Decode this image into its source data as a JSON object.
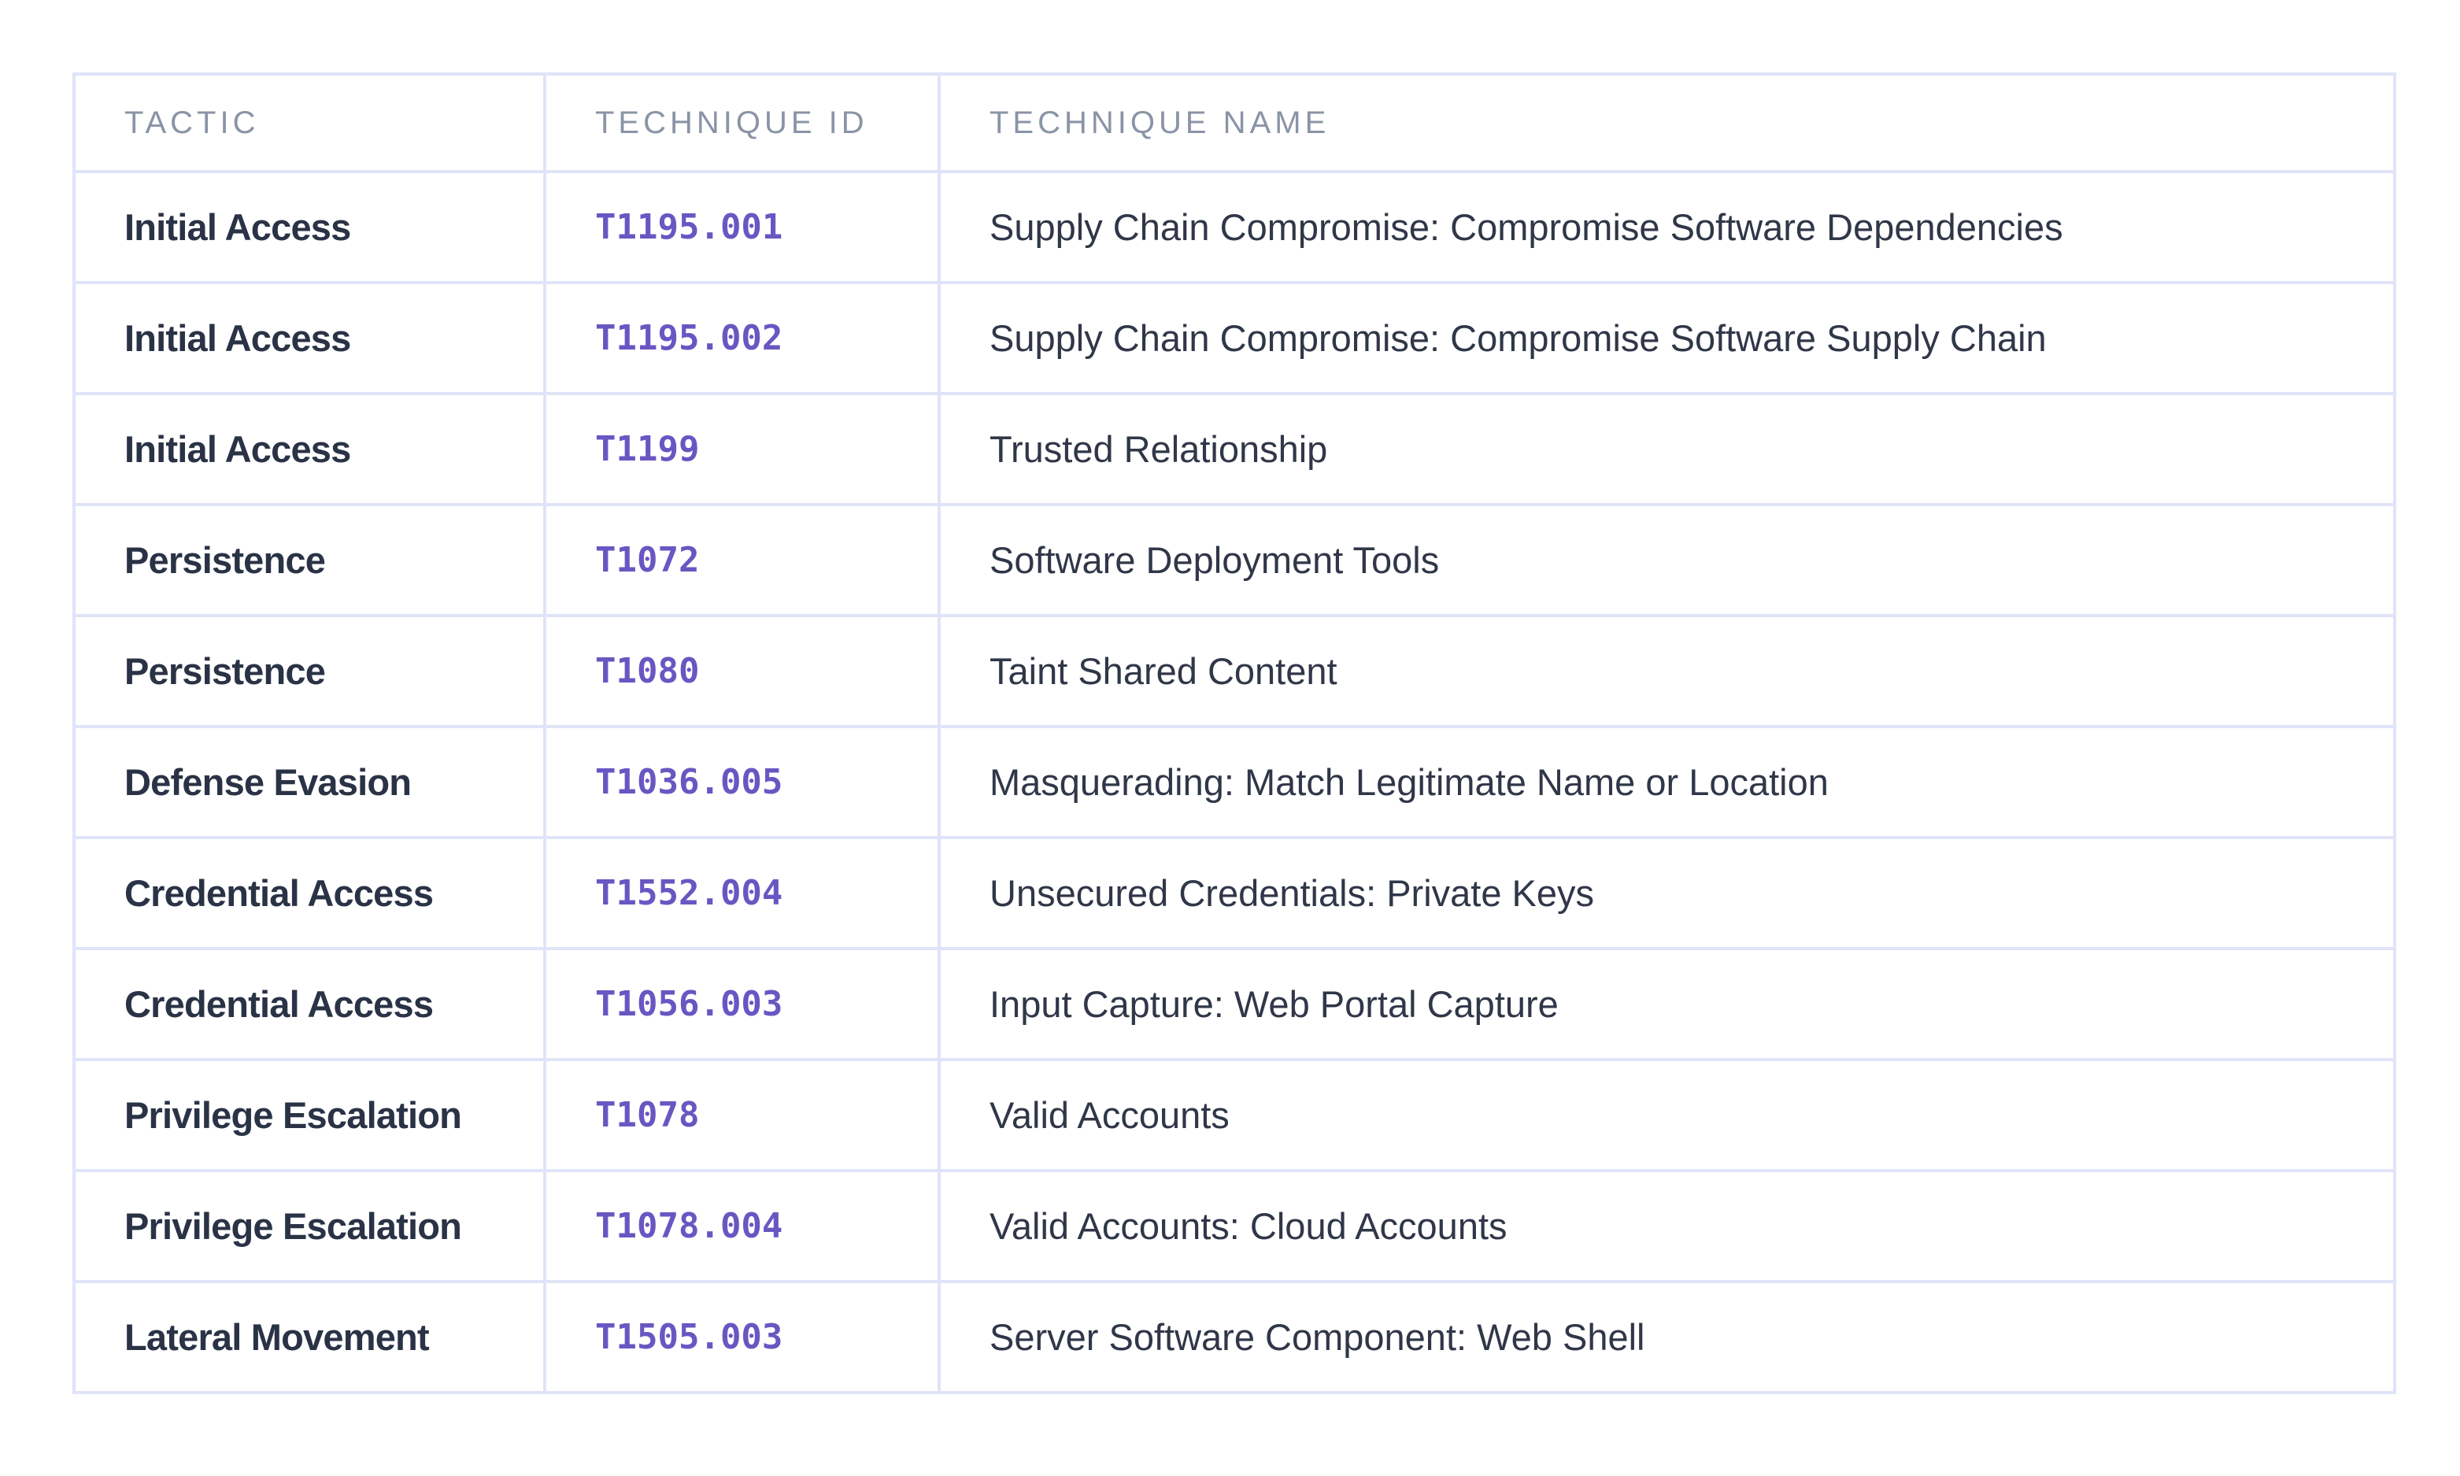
{
  "table": {
    "headers": {
      "tactic": "TACTIC",
      "technique_id": "TECHNIQUE ID",
      "technique_name": "TECHNIQUE NAME"
    },
    "rows": [
      {
        "tactic": "Initial Access",
        "technique_id": "T1195.001",
        "technique_name": "Supply Chain Compromise: Compromise Software Dependencies"
      },
      {
        "tactic": "Initial Access",
        "technique_id": "T1195.002",
        "technique_name": "Supply Chain Compromise: Compromise Software Supply Chain"
      },
      {
        "tactic": "Initial Access",
        "technique_id": "T1199",
        "technique_name": "Trusted Relationship"
      },
      {
        "tactic": "Persistence",
        "technique_id": "T1072",
        "technique_name": "Software Deployment Tools"
      },
      {
        "tactic": "Persistence",
        "technique_id": "T1080",
        "technique_name": "Taint Shared Content"
      },
      {
        "tactic": "Defense Evasion",
        "technique_id": "T1036.005",
        "technique_name": "Masquerading: Match Legitimate Name or Location"
      },
      {
        "tactic": "Credential Access",
        "technique_id": "T1552.004",
        "technique_name": "Unsecured Credentials: Private Keys"
      },
      {
        "tactic": "Credential Access",
        "technique_id": "T1056.003",
        "technique_name": "Input Capture: Web Portal Capture"
      },
      {
        "tactic": "Privilege Escalation",
        "technique_id": "T1078",
        "technique_name": "Valid Accounts"
      },
      {
        "tactic": "Privilege Escalation",
        "technique_id": "T1078.004",
        "technique_name": "Valid Accounts: Cloud Accounts"
      },
      {
        "tactic": "Lateral Movement",
        "technique_id": "T1505.003",
        "technique_name": "Server Software Component: Web Shell"
      }
    ]
  },
  "colors": {
    "border": "#dfe4f8",
    "header_text": "#8a94a6",
    "tactic_text": "#2a3346",
    "technique_id_text": "#6a56c2",
    "technique_name_text": "#2f3748"
  }
}
